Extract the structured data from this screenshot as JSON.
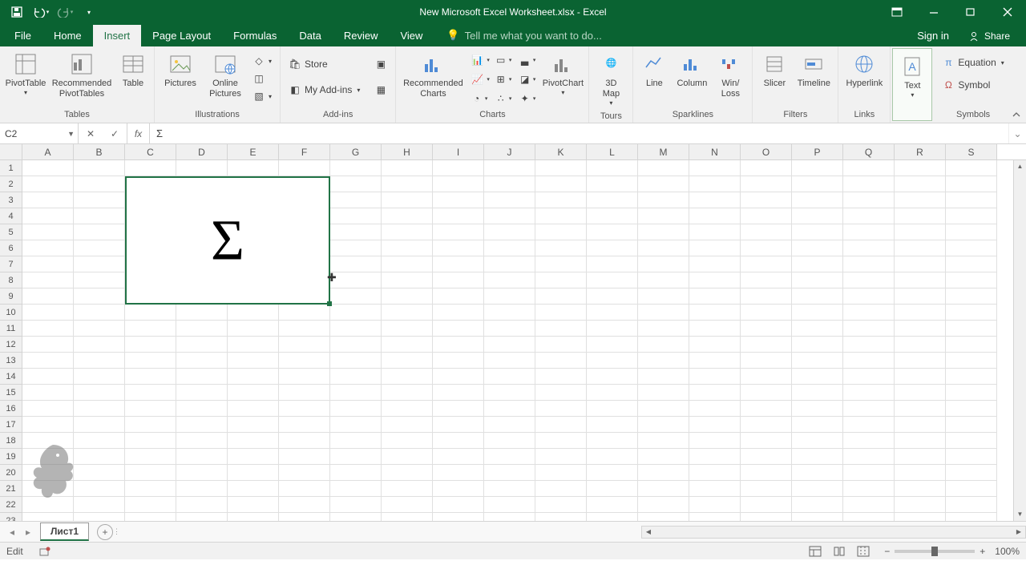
{
  "title": "New Microsoft Excel Worksheet.xlsx - Excel",
  "tabs": {
    "file": "File",
    "home": "Home",
    "insert": "Insert",
    "page_layout": "Page Layout",
    "formulas": "Formulas",
    "data": "Data",
    "review": "Review",
    "view": "View"
  },
  "tell_me": "Tell me what you want to do...",
  "signin": "Sign in",
  "share": "Share",
  "ribbon": {
    "tables": {
      "pivot": "PivotTable",
      "rec_pivot": "Recommended PivotTables",
      "table": "Table",
      "label": "Tables"
    },
    "illus": {
      "pictures": "Pictures",
      "online": "Online Pictures",
      "label": "Illustrations"
    },
    "addins": {
      "store": "Store",
      "my": "My Add-ins",
      "label": "Add-ins"
    },
    "charts": {
      "rec": "Recommended Charts",
      "pivotchart": "PivotChart",
      "label": "Charts"
    },
    "tours": {
      "map": "3D Map",
      "label": "Tours"
    },
    "spark": {
      "line": "Line",
      "col": "Column",
      "winloss": "Win/ Loss",
      "label": "Sparklines"
    },
    "filters": {
      "slicer": "Slicer",
      "timeline": "Timeline",
      "label": "Filters"
    },
    "links": {
      "hyper": "Hyperlink",
      "label": "Links"
    },
    "text": {
      "text": "Text",
      "label": ""
    },
    "symbols": {
      "eq": "Equation",
      "sym": "Symbol",
      "label": "Symbols"
    }
  },
  "namebox": "C2",
  "formula": "Σ",
  "columns": [
    "A",
    "B",
    "C",
    "D",
    "E",
    "F",
    "G",
    "H",
    "I",
    "J",
    "K",
    "L",
    "M",
    "N",
    "O",
    "P",
    "Q",
    "R",
    "S"
  ],
  "rows": [
    "1",
    "2",
    "3",
    "4",
    "5",
    "6",
    "7",
    "8",
    "9",
    "10",
    "11",
    "12",
    "13",
    "14",
    "15",
    "16",
    "17",
    "18",
    "19",
    "20",
    "21",
    "22",
    "23"
  ],
  "cell_content": "Σ",
  "sheet_tab": "Лист1",
  "status_mode": "Edit",
  "zoom": "100%"
}
